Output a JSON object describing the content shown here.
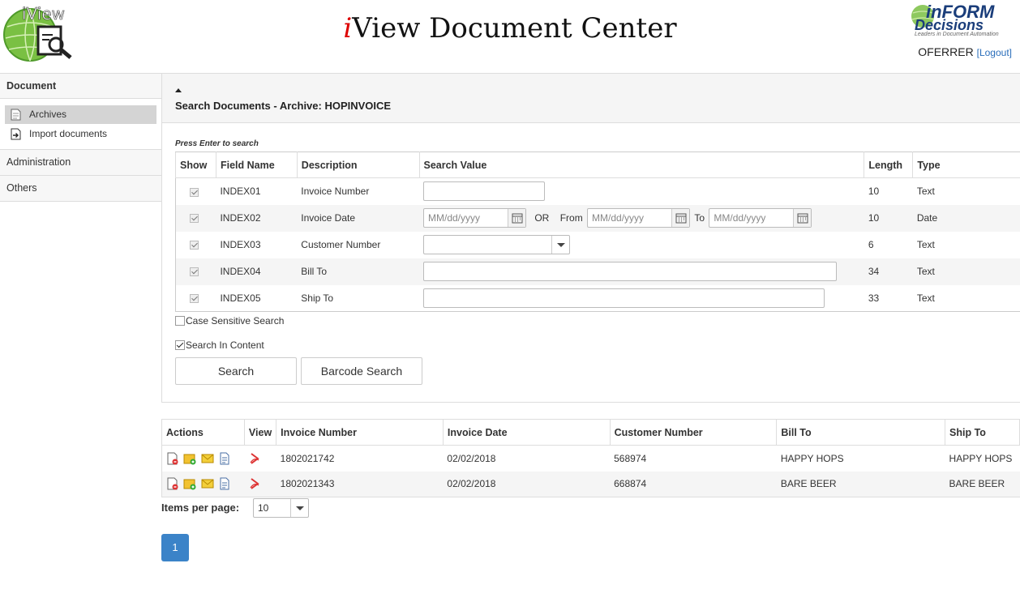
{
  "header": {
    "logo_text": "iView",
    "title_prefix": "i",
    "title_rest": "View Document Center",
    "brand_main": "inFORM",
    "brand_sub": "Decisions",
    "brand_tagline": "Leaders in Document Automation",
    "username": "OFERRER",
    "logout_label": "[Logout]"
  },
  "sidebar": {
    "section": "Document",
    "items": [
      {
        "label": "Archives",
        "icon": "document-icon",
        "active": true
      },
      {
        "label": "Import documents",
        "icon": "import-icon",
        "active": false
      }
    ],
    "groups": [
      "Administration",
      "Others"
    ]
  },
  "search": {
    "title": "Search Documents - Archive: HOPINVOICE",
    "hint": "Press Enter to search",
    "columns": [
      "Show",
      "Field Name",
      "Description",
      "Search Value",
      "Length",
      "Type"
    ],
    "fields": [
      {
        "field": "INDEX01",
        "description": "Invoice Number",
        "length": "10",
        "type": "Text"
      },
      {
        "field": "INDEX02",
        "description": "Invoice Date",
        "length": "10",
        "type": "Date"
      },
      {
        "field": "INDEX03",
        "description": "Customer Number",
        "length": "6",
        "type": "Text"
      },
      {
        "field": "INDEX04",
        "description": "Bill To",
        "length": "34",
        "type": "Text"
      },
      {
        "field": "INDEX05",
        "description": "Ship To",
        "length": "33",
        "type": "Text"
      }
    ],
    "date_placeholder": "MM/dd/yyyy",
    "or_label": "OR",
    "from_label": "From",
    "to_label": "To",
    "case_sensitive_label": "Case Sensitive Search",
    "case_sensitive_checked": false,
    "search_content_label": "Search In Content",
    "search_content_checked": true,
    "search_button": "Search",
    "barcode_button": "Barcode Search"
  },
  "results": {
    "columns": [
      "Actions",
      "View",
      "Invoice Number",
      "Invoice Date",
      "Customer Number",
      "Bill To",
      "Ship To"
    ],
    "rows": [
      {
        "invoice_number": "1802021742",
        "invoice_date": "02/02/2018",
        "customer_number": "568974",
        "bill_to": "HAPPY HOPS",
        "ship_to": "HAPPY HOPS"
      },
      {
        "invoice_number": "1802021343",
        "invoice_date": "02/02/2018",
        "customer_number": "668874",
        "bill_to": "BARE BEER",
        "ship_to": "BARE BEER"
      }
    ],
    "items_per_page_label": "Items per page:",
    "items_per_page_value": "10",
    "current_page": "1"
  }
}
